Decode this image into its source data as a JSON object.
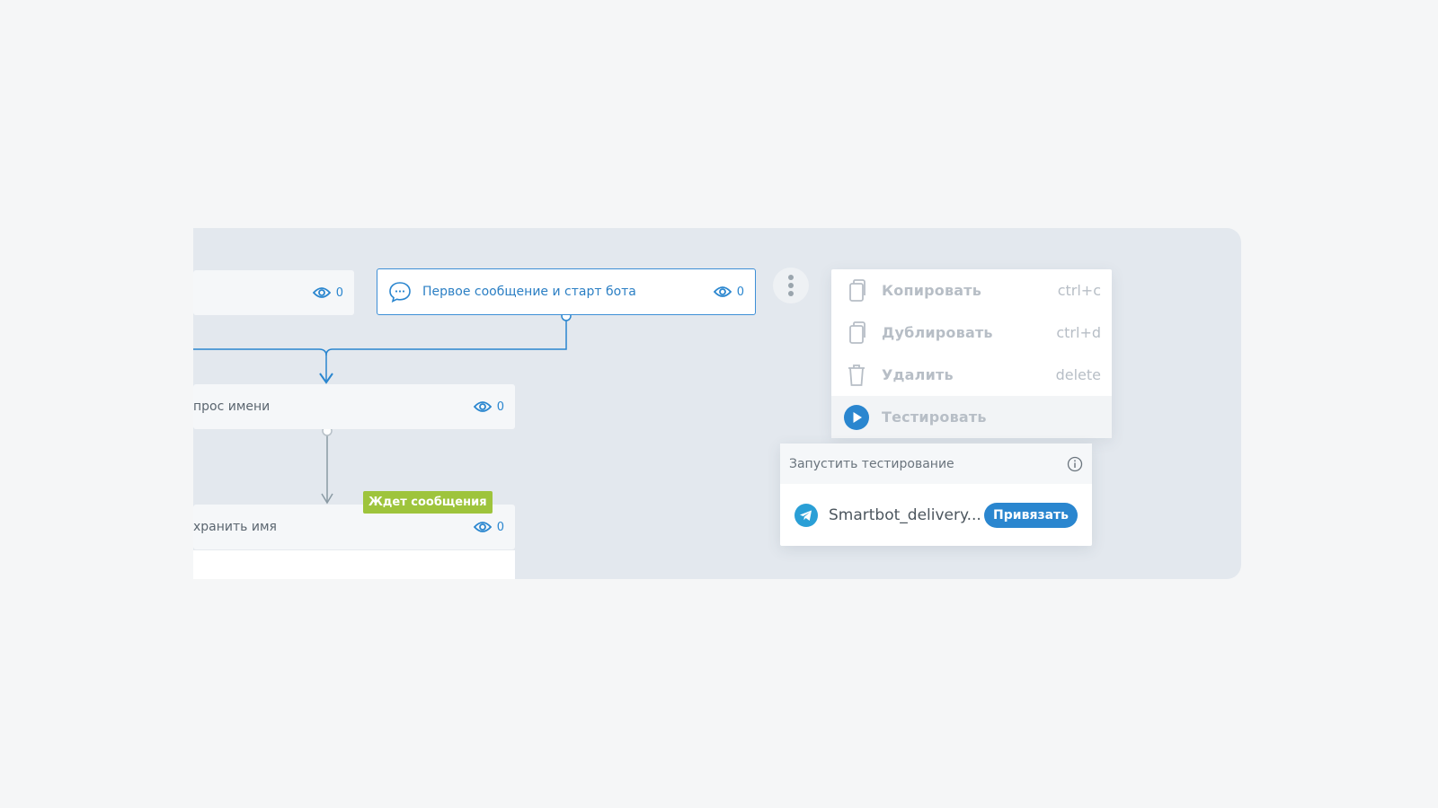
{
  "nodes": [
    {
      "id": "left-node",
      "title": "",
      "views": "0"
    },
    {
      "id": "first-message",
      "title": "Первое сообщение и старт бота",
      "views": "0"
    },
    {
      "id": "name-request",
      "title": "прос имени",
      "views": "0"
    },
    {
      "id": "save-name",
      "title": "хранить имя",
      "views": "0"
    }
  ],
  "badge": {
    "label": "Ждет сообщения"
  },
  "context_menu": {
    "items": [
      {
        "label": "Копировать",
        "shortcut": "ctrl+c",
        "icon": "copy-icon"
      },
      {
        "label": "Дублировать",
        "shortcut": "ctrl+d",
        "icon": "duplicate-icon"
      },
      {
        "label": "Удалить",
        "shortcut": "delete",
        "icon": "trash-icon"
      },
      {
        "label": "Тестировать",
        "shortcut": "",
        "icon": "play-icon"
      }
    ]
  },
  "test_panel": {
    "title": "Запустить тестирование",
    "bot_name": "Smartbot_delivery...",
    "bind_label": "Привязать"
  },
  "colors": {
    "accent": "#2a86cf",
    "badge": "#9ec43c",
    "canvas": "#e3e8ee"
  }
}
